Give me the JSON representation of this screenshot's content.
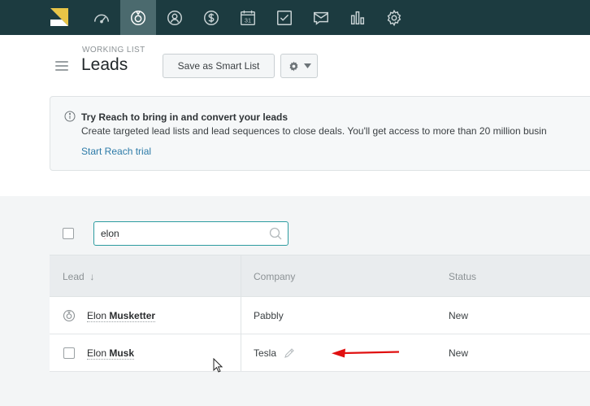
{
  "nav": {
    "items": [
      {
        "icon": "speedometer-icon"
      },
      {
        "icon": "target-icon",
        "active": true
      },
      {
        "icon": "user-icon"
      },
      {
        "icon": "dollar-icon"
      },
      {
        "icon": "calendar-icon",
        "text": "31"
      },
      {
        "icon": "checkbox-icon"
      },
      {
        "icon": "email-icon"
      },
      {
        "icon": "bar-chart-icon"
      },
      {
        "icon": "gear-icon"
      }
    ],
    "colors": {
      "bar": "#1c3b40",
      "active": "#4b6a6e",
      "logo_yellow": "#e8c547"
    }
  },
  "header": {
    "eyebrow": "WORKING LIST",
    "title": "Leads",
    "save_smart_list": "Save as Smart List"
  },
  "banner": {
    "title": "Try Reach to bring in and convert your leads",
    "body": "Create targeted lead lists and lead sequences to close deals. You'll get access to more than 20 million busin",
    "link": "Start Reach trial"
  },
  "search": {
    "value": "elon"
  },
  "table": {
    "headers": {
      "lead": "Lead",
      "sort_indicator": "↓",
      "company": "Company",
      "status": "Status"
    },
    "rows": [
      {
        "lead_first": "Elon ",
        "lead_match": "Musketter",
        "company": "Pabbly",
        "status": "New"
      },
      {
        "lead_first": "Elon ",
        "lead_match": "Musk",
        "company": "Tesla",
        "status": "New"
      }
    ]
  },
  "accent_colors": {
    "link": "#2d7ba8",
    "search_border": "#2d9ca0",
    "annotation_arrow": "#e01010"
  }
}
